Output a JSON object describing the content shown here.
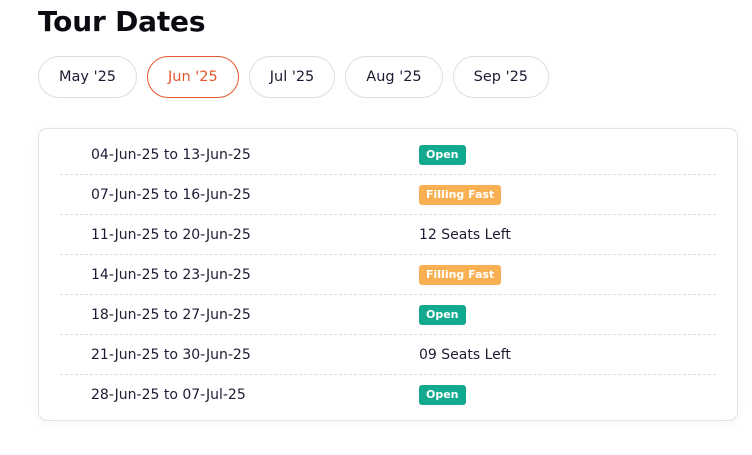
{
  "page": {
    "title": "Tour Dates"
  },
  "tabs": [
    {
      "label": "May '25",
      "active": false
    },
    {
      "label": "Jun '25",
      "active": true
    },
    {
      "label": "Jul '25",
      "active": false
    },
    {
      "label": "Aug '25",
      "active": false
    },
    {
      "label": "Sep '25",
      "active": false
    }
  ],
  "colors": {
    "accent": "#e4572e",
    "open_badge": "#12a98f",
    "filling_fast_badge": "#f8b052"
  },
  "dates": [
    {
      "range": "04-Jun-25 to 13-Jun-25",
      "status": "Open",
      "status_type": "badge-open"
    },
    {
      "range": "07-Jun-25 to 16-Jun-25",
      "status": "Filling Fast",
      "status_type": "badge-fast"
    },
    {
      "range": "11-Jun-25 to 20-Jun-25",
      "status": "12 Seats Left",
      "status_type": "text"
    },
    {
      "range": "14-Jun-25 to 23-Jun-25",
      "status": "Filling Fast",
      "status_type": "badge-fast"
    },
    {
      "range": "18-Jun-25 to 27-Jun-25",
      "status": "Open",
      "status_type": "badge-open"
    },
    {
      "range": "21-Jun-25 to 30-Jun-25",
      "status": "09 Seats Left",
      "status_type": "text"
    },
    {
      "range": "28-Jun-25 to 07-Jul-25",
      "status": "Open",
      "status_type": "badge-open"
    }
  ]
}
